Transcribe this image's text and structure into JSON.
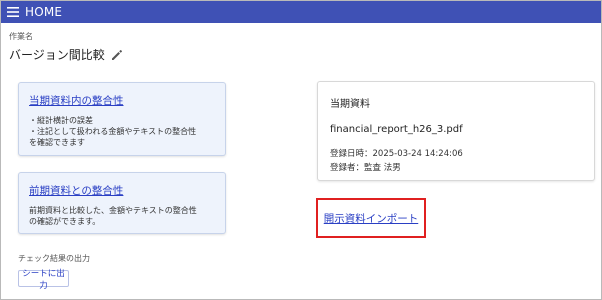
{
  "header": {
    "title": "HOME",
    "menu_icon": "hamburger-menu-icon"
  },
  "task": {
    "label": "作業名",
    "name": "バージョン間比較",
    "edit_icon": "pencil-icon"
  },
  "checks": [
    {
      "title": "当期資料内の整合性",
      "lines": [
        "・縦計横計の誤差",
        "・注記として扱われる金額やテキストの整合性",
        "を確認できます"
      ]
    },
    {
      "title": "前期資料との整合性",
      "lines": [
        "前期資料と比較した、金額やテキストの整合性",
        "の確認ができます。"
      ]
    }
  ],
  "current_document": {
    "heading": "当期資料",
    "filename": "financial_report_h26_3.pdf",
    "registered_at": "登録日時：2025-03-24 14:24:06",
    "registered_by": "登録者：監査 法男"
  },
  "import_link": "開示資料インポート",
  "output": {
    "label": "チェック結果の出力",
    "button": "シートに出力"
  },
  "colors": {
    "header_bg": "#3f51b5",
    "link": "#2a3fc4",
    "highlight_border": "#e02020",
    "card_bg": "#eef3fc"
  }
}
